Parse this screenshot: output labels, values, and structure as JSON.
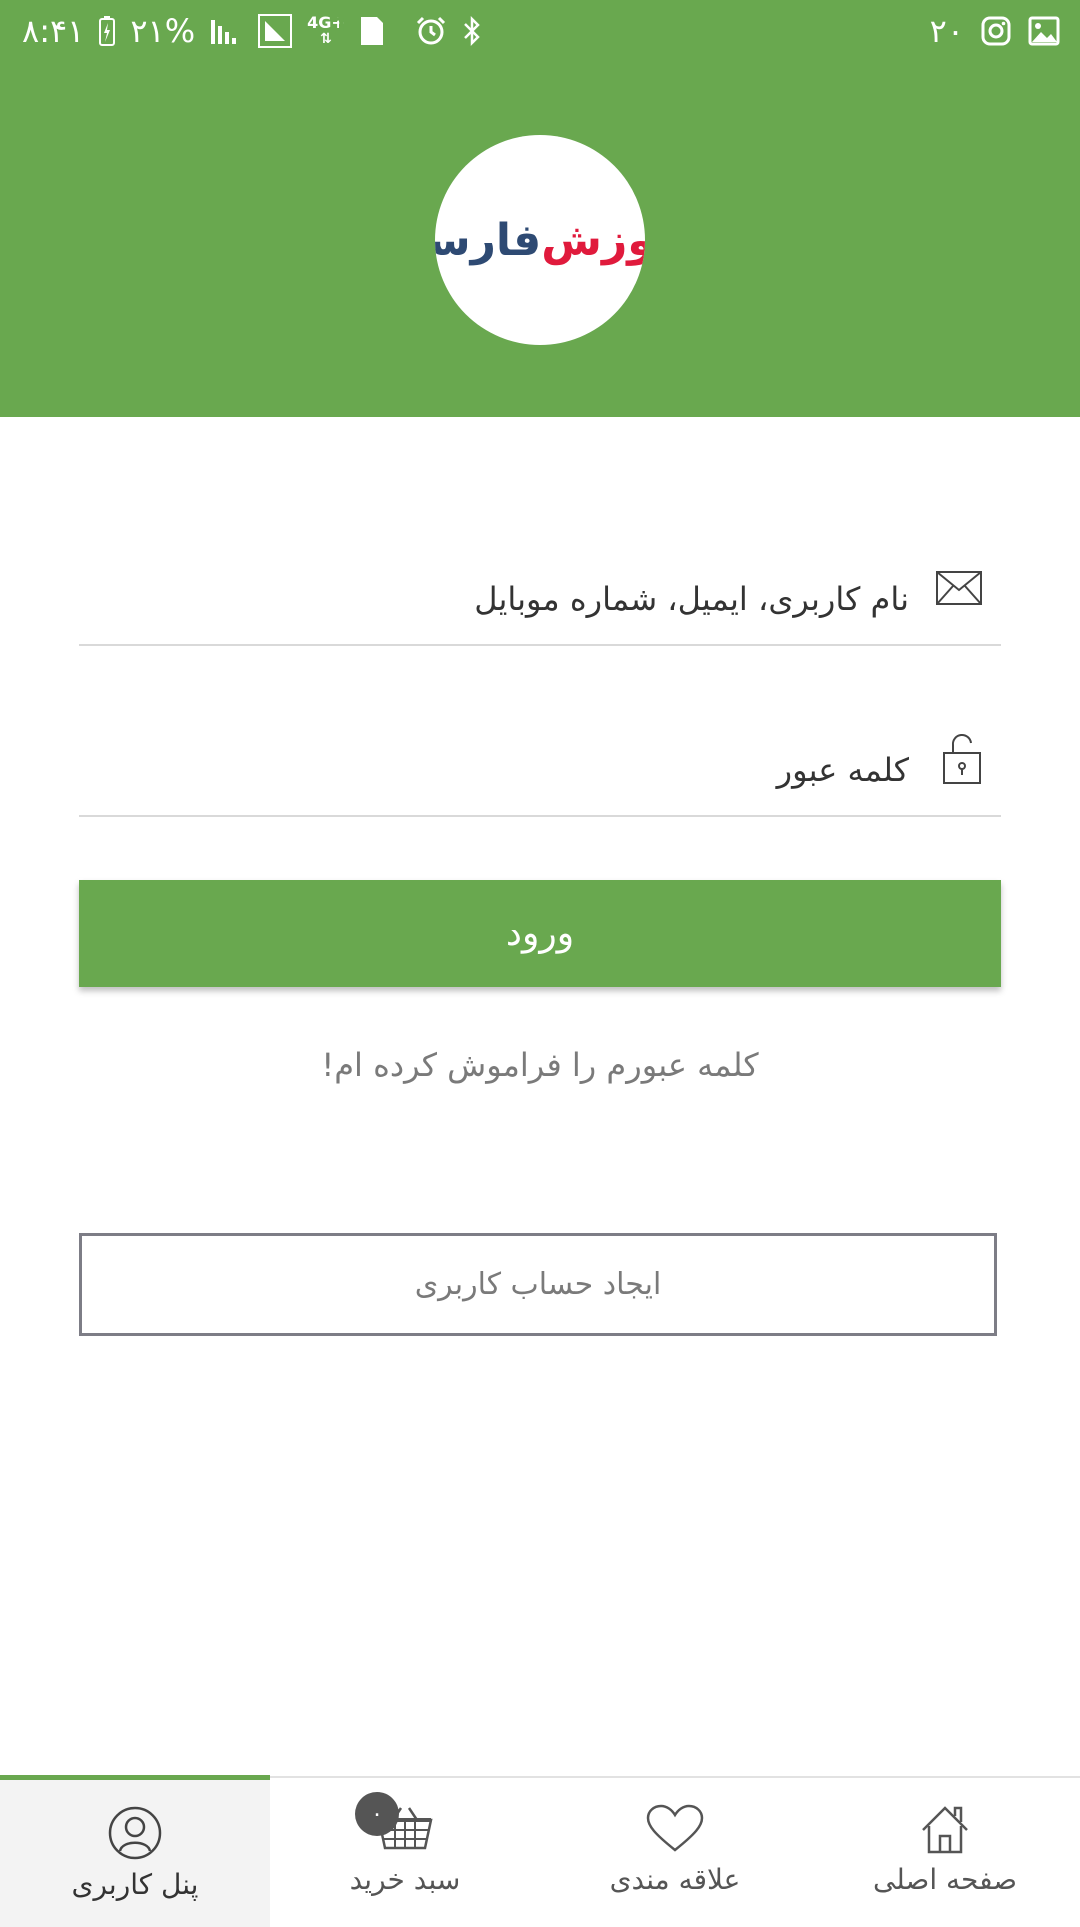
{
  "status_bar": {
    "time": "۸:۴۱",
    "battery": "۲۱%",
    "network": "4G+",
    "sim_slot": "1",
    "notification_count": "۲۰"
  },
  "header": {
    "background_color": "#69a84f",
    "logo_text_blue": "فارسی",
    "logo_text_red": "آموزش"
  },
  "form": {
    "username_label": "نام کاربری، ایمیل، شماره موبایل",
    "password_label": "کلمه عبور",
    "login_button": "ورود",
    "forgot_link": "کلمه عبورم را فراموش کرده ام!",
    "create_account_button": "ایجاد حساب کاربری"
  },
  "bottom_nav": {
    "items": [
      {
        "label": "پنل کاربری",
        "icon": "user-circle-icon",
        "active": true
      },
      {
        "label": "سبد خرید",
        "icon": "basket-icon",
        "badge": "۰"
      },
      {
        "label": "علاقه مندی",
        "icon": "heart-icon"
      },
      {
        "label": "صفحه اصلی",
        "icon": "home-icon"
      }
    ]
  },
  "colors": {
    "accent": "#69a84f"
  }
}
